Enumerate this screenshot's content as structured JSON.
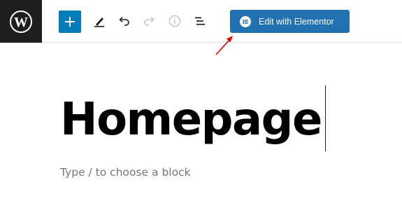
{
  "toolbar": {
    "logo_icon": "wordpress-icon",
    "add_block_icon": "plus-icon",
    "tools": [
      {
        "name": "edit-icon"
      },
      {
        "name": "undo-icon"
      },
      {
        "name": "redo-icon"
      },
      {
        "name": "info-icon"
      },
      {
        "name": "list-view-icon"
      }
    ],
    "elementor_button_label": "Edit with Elementor",
    "elementor_icon": "elementor-icon"
  },
  "editor": {
    "title": "Homepage",
    "block_placeholder": "Type / to choose a block"
  },
  "colors": {
    "logo_bg": "#1e1e1e",
    "add_button": "#007cba",
    "elementor_button": "#2271b1",
    "annotation_arrow": "#e00000",
    "placeholder_text": "#757575"
  }
}
